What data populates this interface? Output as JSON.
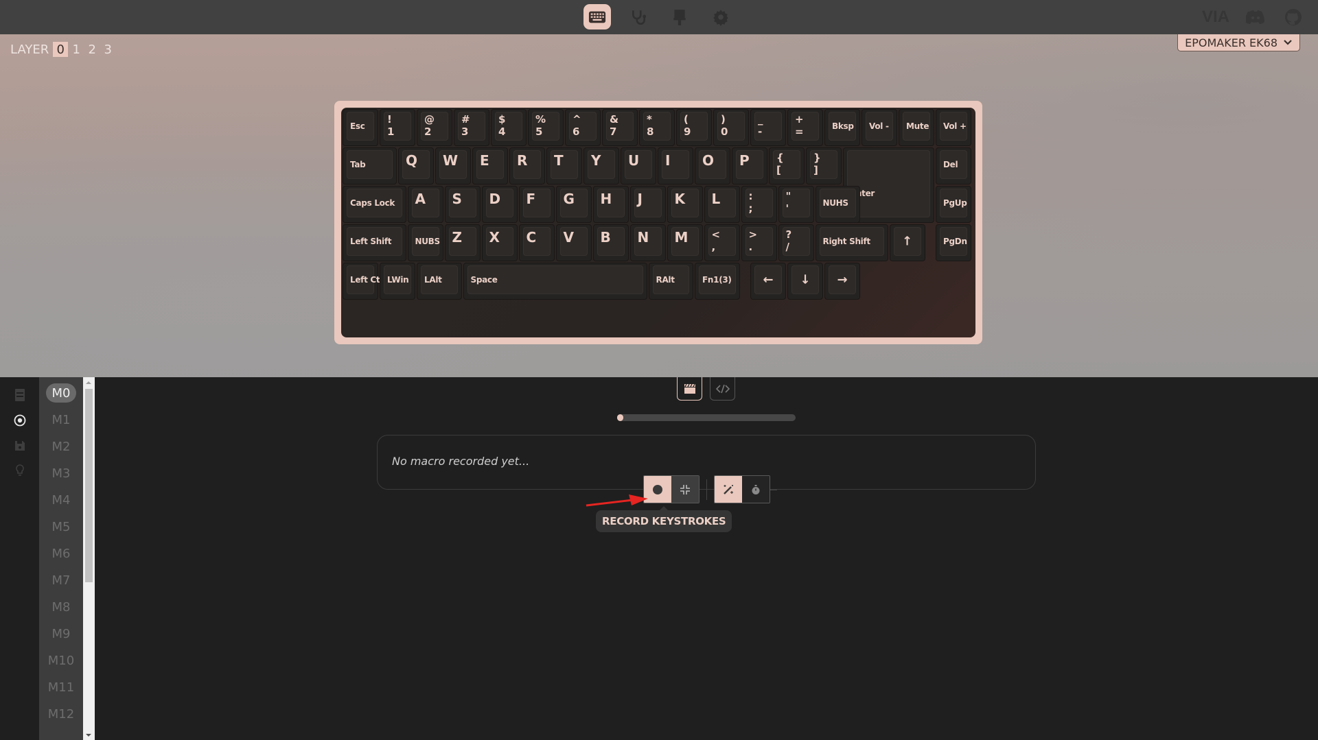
{
  "header": {
    "nav": [
      {
        "name": "keyboard-icon",
        "label": "Configure",
        "active": true
      },
      {
        "name": "stethoscope-icon",
        "label": "Test",
        "active": false
      },
      {
        "name": "paintbrush-icon",
        "label": "Design",
        "active": false
      },
      {
        "name": "gear-icon",
        "label": "Settings",
        "active": false
      }
    ],
    "external": [
      {
        "name": "via-logo",
        "label": "VIA"
      },
      {
        "name": "discord-icon",
        "label": ""
      },
      {
        "name": "github-icon",
        "label": ""
      }
    ]
  },
  "layers": {
    "label": "LAYER",
    "items": [
      "0",
      "1",
      "2",
      "3"
    ],
    "active": "0"
  },
  "keyboard_selector": {
    "value": "EPOMAKER EK68"
  },
  "colors": {
    "accent": "#eac8bd",
    "header_bg": "#414141",
    "panel_bg": "#1f1f1f",
    "key_text": "#ecd0c6",
    "annotation_arrow": "#e52521"
  },
  "keyboard": {
    "rows": [
      [
        {
          "t": "Esc"
        },
        {
          "top": "!",
          "bot": "1"
        },
        {
          "top": "@",
          "bot": "2"
        },
        {
          "top": "#",
          "bot": "3"
        },
        {
          "top": "$",
          "bot": "4"
        },
        {
          "top": "%",
          "bot": "5"
        },
        {
          "top": "^",
          "bot": "6"
        },
        {
          "top": "&",
          "bot": "7"
        },
        {
          "top": "*",
          "bot": "8"
        },
        {
          "top": "(",
          "bot": "9"
        },
        {
          "top": ")",
          "bot": "0"
        },
        {
          "top": "_",
          "bot": "-"
        },
        {
          "top": "+",
          "bot": "="
        },
        {
          "t": "Bksp"
        },
        {
          "t": "Vol -"
        },
        {
          "t": "Mute"
        },
        {
          "t": "Vol +"
        }
      ],
      [
        {
          "t": "Tab"
        },
        {
          "l": "Q"
        },
        {
          "l": "W"
        },
        {
          "l": "E"
        },
        {
          "l": "R"
        },
        {
          "l": "T"
        },
        {
          "l": "Y"
        },
        {
          "l": "U"
        },
        {
          "l": "I"
        },
        {
          "l": "O"
        },
        {
          "l": "P"
        },
        {
          "top": "{",
          "bot": "["
        },
        {
          "top": "}",
          "bot": "]"
        },
        {
          "t": "Enter"
        },
        {
          "t": "Del"
        }
      ],
      [
        {
          "t": "Caps Lock"
        },
        {
          "l": "A"
        },
        {
          "l": "S"
        },
        {
          "l": "D"
        },
        {
          "l": "F"
        },
        {
          "l": "G"
        },
        {
          "l": "H"
        },
        {
          "l": "J"
        },
        {
          "l": "K"
        },
        {
          "l": "L"
        },
        {
          "top": ":",
          "bot": ";"
        },
        {
          "top": "\"",
          "bot": "'"
        },
        {
          "t": "NUHS"
        },
        {
          "t": "PgUp"
        }
      ],
      [
        {
          "t": "Left Shift"
        },
        {
          "t": "NUBS"
        },
        {
          "l": "Z"
        },
        {
          "l": "X"
        },
        {
          "l": "C"
        },
        {
          "l": "V"
        },
        {
          "l": "B"
        },
        {
          "l": "N"
        },
        {
          "l": "M"
        },
        {
          "top": "<",
          "bot": ","
        },
        {
          "top": ">",
          "bot": "."
        },
        {
          "top": "?",
          "bot": "/"
        },
        {
          "t": "Right Shift"
        },
        {
          "a": "↑"
        },
        {
          "t": "PgDn"
        }
      ],
      [
        {
          "t": "Left Ctrl"
        },
        {
          "t": "LWin"
        },
        {
          "t": "LAlt"
        },
        {
          "t": "Space"
        },
        {
          "t": "RAlt"
        },
        {
          "t": "Fn1(3)"
        },
        {
          "a": "←"
        },
        {
          "a": "↓"
        },
        {
          "a": "→"
        }
      ]
    ]
  },
  "sidebar": {
    "icons": [
      {
        "name": "document-icon",
        "active": false
      },
      {
        "name": "record-circle-icon",
        "active": true
      },
      {
        "name": "save-icon",
        "active": false
      },
      {
        "name": "lightbulb-icon",
        "active": false
      }
    ]
  },
  "macros": {
    "items": [
      "M0",
      "M1",
      "M2",
      "M3",
      "M4",
      "M5",
      "M6",
      "M7",
      "M8",
      "M9",
      "M10",
      "M11",
      "M12"
    ],
    "active": "M0"
  },
  "macro_editor": {
    "tabs": [
      {
        "name": "record-tab",
        "icon": "clapperboard-icon",
        "active": true
      },
      {
        "name": "code-tab",
        "icon": "code-icon",
        "active": false
      }
    ],
    "progress_fraction": 0.0,
    "empty_text": "No macro recorded yet...",
    "toolbar": {
      "record": {
        "icon": "record-dot-icon",
        "tooltip": "RECORD KEYSTROKES"
      },
      "compress": {
        "icon": "compress-icon"
      },
      "smart_optimize": {
        "icon": "magic-wand-icon"
      },
      "delays": {
        "icon": "stopwatch-icon"
      }
    },
    "tooltip": "RECORD KEYSTROKES"
  }
}
